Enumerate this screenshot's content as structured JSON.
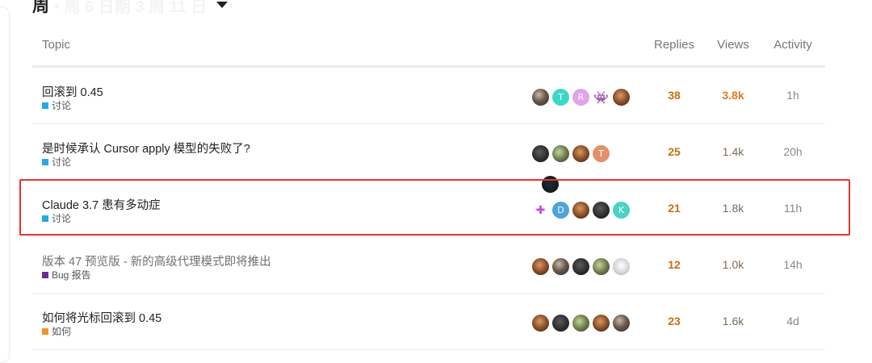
{
  "heading": {
    "title": "周",
    "subtitle": "• 周 6 日期 3 周 11 日"
  },
  "columns": {
    "topic": "Topic",
    "replies": "Replies",
    "views": "Views",
    "activity": "Activity"
  },
  "topics": [
    {
      "title": "回滚到 0.45",
      "category": "讨论",
      "category_color": "#25aae2",
      "posters": [
        {
          "icon": "photo-avatar",
          "letter": ""
        },
        {
          "icon": "letter-avatar",
          "letter": "T",
          "color": "#3ad8c8"
        },
        {
          "icon": "letter-avatar",
          "letter": "R",
          "color": "#e0a3ec"
        },
        {
          "icon": "invader-avatar",
          "letter": "👾"
        },
        {
          "icon": "photo-avatar",
          "letter": ""
        }
      ],
      "replies": "38",
      "views": "3.8k",
      "activity": "1h"
    },
    {
      "title": "是时候承认 Cursor apply 模型的失败了?",
      "category": "讨论",
      "category_color": "#25aae2",
      "posters": [
        {
          "icon": "photo-avatar",
          "letter": ""
        },
        {
          "icon": "photo-avatar",
          "letter": ""
        },
        {
          "icon": "photo-avatar",
          "letter": ""
        },
        {
          "icon": "letter-avatar",
          "letter": "T",
          "color": "#e2906a"
        },
        {
          "icon": "cat-avatar",
          "letter": ""
        }
      ],
      "replies": "25",
      "views": "1.4k",
      "activity": "20h"
    },
    {
      "title": "Claude 3.7 患有多动症",
      "category": "讨论",
      "category_color": "#25aae2",
      "posters": [
        {
          "icon": "pixel-avatar",
          "letter": "✚"
        },
        {
          "icon": "letter-avatar",
          "letter": "D",
          "color": "#4fa3d8"
        },
        {
          "icon": "photo-avatar",
          "letter": ""
        },
        {
          "icon": "photo-avatar",
          "letter": ""
        },
        {
          "icon": "letter-avatar",
          "letter": "K",
          "color": "#49d3c4"
        }
      ],
      "replies": "21",
      "views": "1.8k",
      "activity": "11h"
    },
    {
      "title": "版本 47 预览版 - 新的高级代理模式即将推出",
      "category": "Bug 报告",
      "category_color": "#6b2a99",
      "posters": [
        {
          "icon": "photo-avatar",
          "letter": ""
        },
        {
          "icon": "photo-avatar",
          "letter": ""
        },
        {
          "icon": "photo-avatar",
          "letter": ""
        },
        {
          "icon": "photo-avatar",
          "letter": ""
        },
        {
          "icon": "photo-avatar",
          "letter": ""
        }
      ],
      "replies": "12",
      "views": "1.0k",
      "activity": "14h"
    },
    {
      "title": "如何将光标回滚到 0.45",
      "category": "如何",
      "category_color": "#f1932a",
      "posters": [
        {
          "icon": "photo-avatar",
          "letter": ""
        },
        {
          "icon": "photo-avatar",
          "letter": ""
        },
        {
          "icon": "photo-avatar",
          "letter": ""
        },
        {
          "icon": "photo-avatar",
          "letter": ""
        },
        {
          "icon": "photo-avatar",
          "letter": ""
        }
      ],
      "replies": "23",
      "views": "1.6k",
      "activity": "4d"
    }
  ]
}
